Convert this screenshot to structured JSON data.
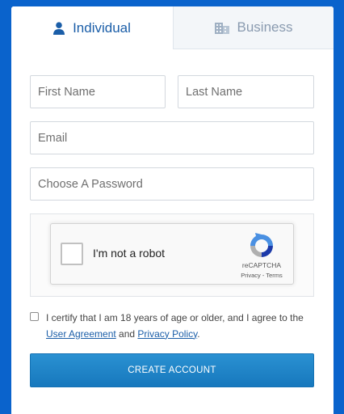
{
  "colors": {
    "page_background": "#0a63cc",
    "active_tab_text": "#1b5ea8",
    "inactive_tab_text": "#8a9bb0",
    "button_background": "#1f86c8",
    "link": "#1b5ea8"
  },
  "tabs": [
    {
      "label": "Individual",
      "icon": "person-icon",
      "active": true
    },
    {
      "label": "Business",
      "icon": "building-icon",
      "active": false
    }
  ],
  "form": {
    "first_name_placeholder": "First Name",
    "last_name_placeholder": "Last Name",
    "email_placeholder": "Email",
    "password_placeholder": "Choose A Password"
  },
  "captcha": {
    "label": "I'm not a robot",
    "brand": "reCAPTCHA",
    "privacy": "Privacy",
    "separator": " - ",
    "terms": "Terms",
    "icon": "recaptcha-logo-icon"
  },
  "agreement": {
    "text_before": "I certify that I am 18 years of age or older, and I agree to the ",
    "user_agreement": "User Agreement",
    "and": " and ",
    "privacy_policy": "Privacy Policy",
    "period": "."
  },
  "submit_label": "CREATE ACCOUNT"
}
